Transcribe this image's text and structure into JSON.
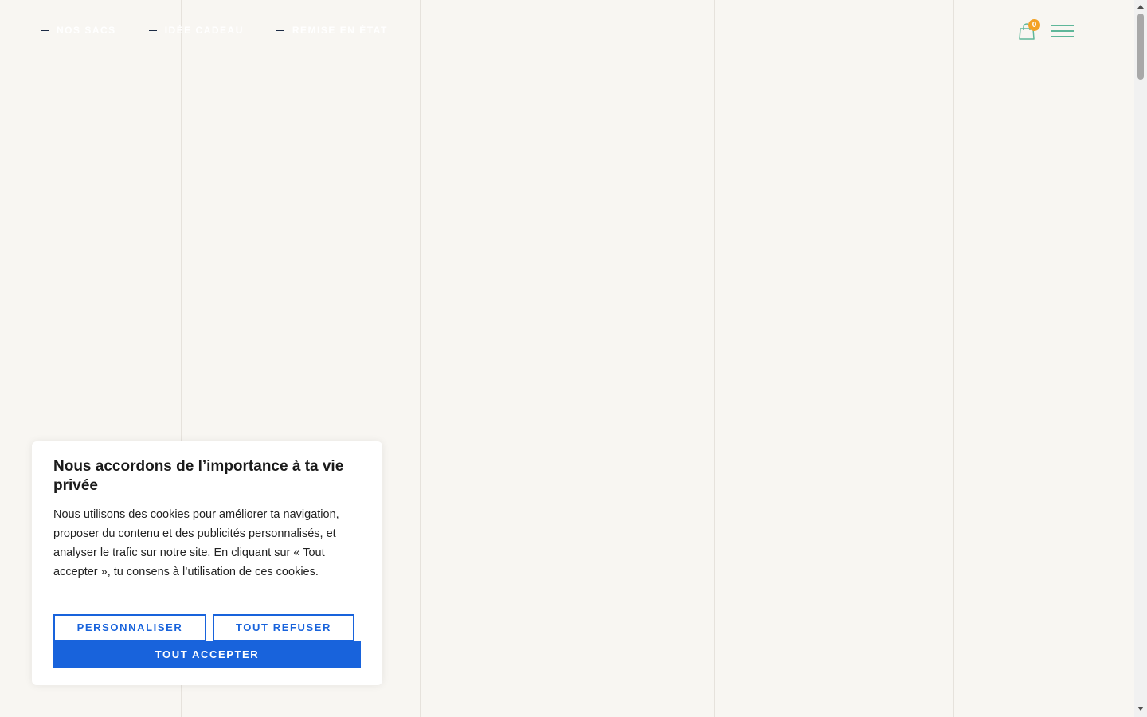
{
  "header": {
    "nav": [
      {
        "label": "NOS SACS"
      },
      {
        "label": "IDÉE CADEAU"
      },
      {
        "label": "REMISE EN ÉTAT"
      }
    ],
    "cart_count": "0"
  },
  "colors": {
    "background": "#f8f6f2",
    "accent_green": "#5fb79a",
    "badge_orange": "#f3a225",
    "button_blue": "#1863dc"
  },
  "cookie_banner": {
    "title": "Nous accordons de l’importance à ta vie privée",
    "text": "Nous utilisons des cookies pour améliorer ta navigation, proposer du contenu et des publicités personnalisés, et analyser le trafic sur notre site. En cliquant sur « Tout accepter », tu consens à l’utilisation de ces cookies.",
    "customize_label": "PERSONNALISER",
    "refuse_label": "TOUT REFUSER",
    "accept_label": "TOUT ACCEPTER"
  }
}
